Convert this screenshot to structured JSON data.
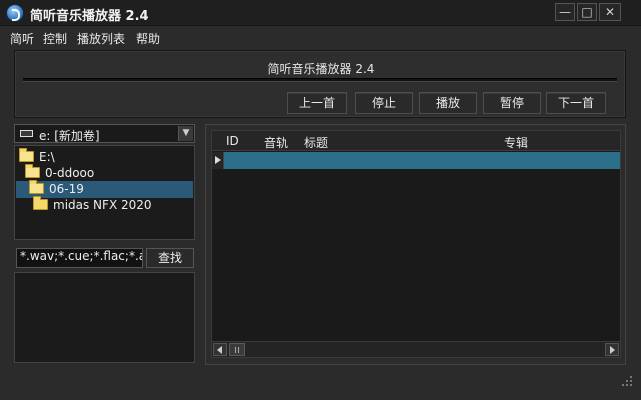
{
  "window": {
    "title": "简听音乐播放器 2.4",
    "icon": "music-app-icon",
    "controls": {
      "minimize": "—",
      "maximize": "□",
      "close": "✕"
    }
  },
  "menu": [
    {
      "label": "简听"
    },
    {
      "label": "控制"
    },
    {
      "label": "播放列表"
    },
    {
      "label": "帮助"
    }
  ],
  "now_playing": {
    "title": "简听音乐播放器 2.4",
    "progress": 0
  },
  "controls": [
    {
      "label": "上一首"
    },
    {
      "label": "停止"
    },
    {
      "label": "播放"
    },
    {
      "label": "暂停"
    },
    {
      "label": "下一首"
    }
  ],
  "browser": {
    "drive": "e: [新加卷]",
    "tree": [
      {
        "label": "E:\\",
        "selected": false
      },
      {
        "label": "0-ddooo",
        "selected": false
      },
      {
        "label": "06-19",
        "selected": true
      },
      {
        "label": "midas NFX 2020",
        "selected": false
      }
    ],
    "filter_value": "*.wav;*.cue;*.flac;*.a",
    "find_label": "查找"
  },
  "playlist": {
    "columns": [
      "ID",
      "音轨",
      "标题",
      "专辑"
    ],
    "rows": [
      {
        "id": "",
        "track": "",
        "title": "",
        "album": ""
      }
    ]
  },
  "colors": {
    "background": "#2b2b2b",
    "selection": "#2b5a78",
    "playlist_row": "#2b6f8a"
  }
}
